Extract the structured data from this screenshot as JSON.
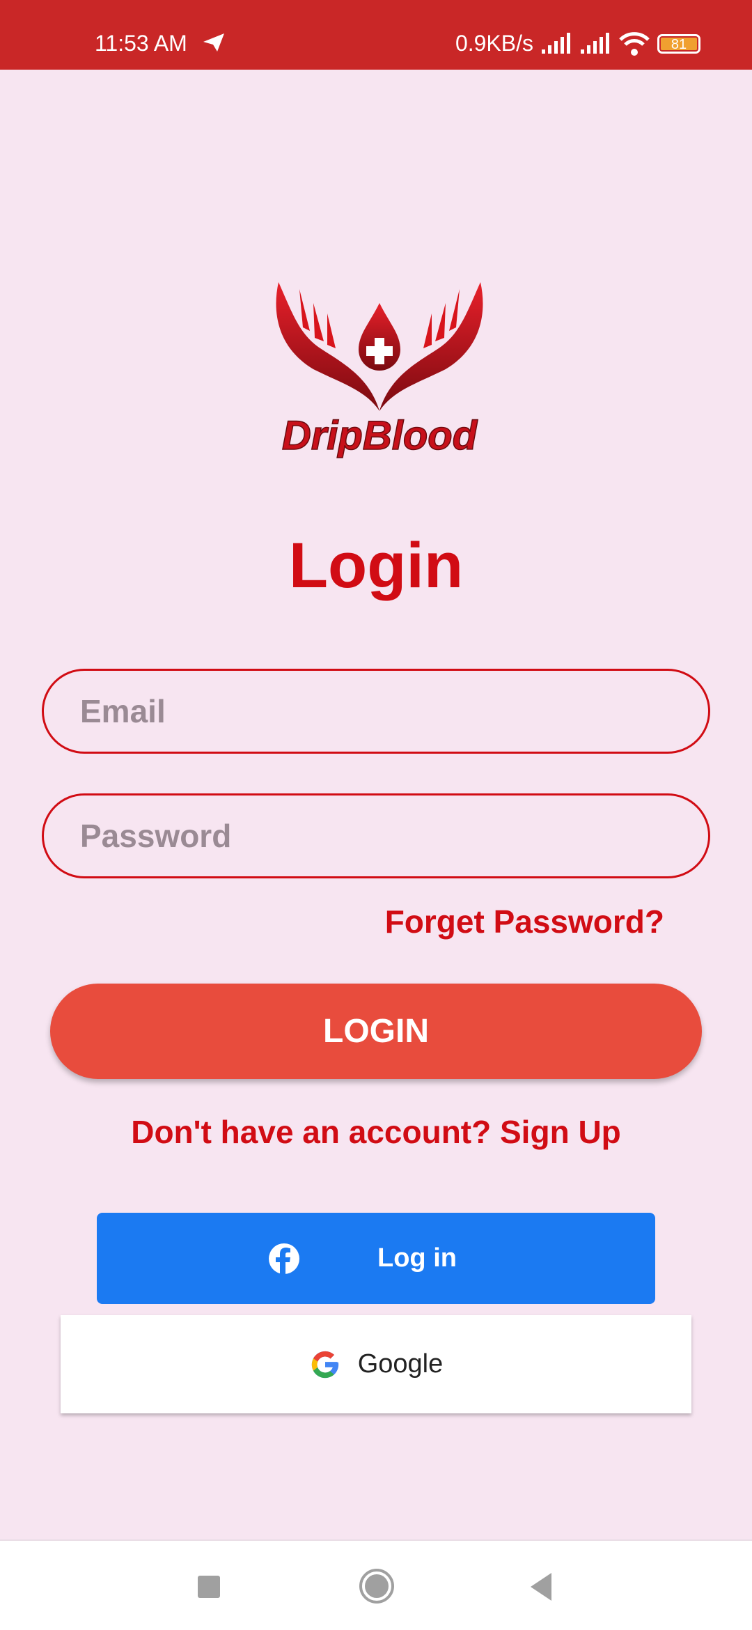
{
  "status": {
    "time": "11:53 AM",
    "net_speed": "0.9KB/s",
    "battery": "81"
  },
  "logo": {
    "text": "DripBlood"
  },
  "title": "Login",
  "email": {
    "placeholder": "Email",
    "value": ""
  },
  "password": {
    "placeholder": "Password",
    "value": ""
  },
  "forget_label": "Forget Password?",
  "login_label": "LOGIN",
  "signup_label": "Don't have an account? Sign Up",
  "facebook_label": "Log in",
  "google_label": "Google",
  "colors": {
    "accent": "#d10c14",
    "button": "#e84c3d",
    "facebook": "#1b7af2",
    "status_bar": "#c92727",
    "background": "#f7e5f1"
  }
}
